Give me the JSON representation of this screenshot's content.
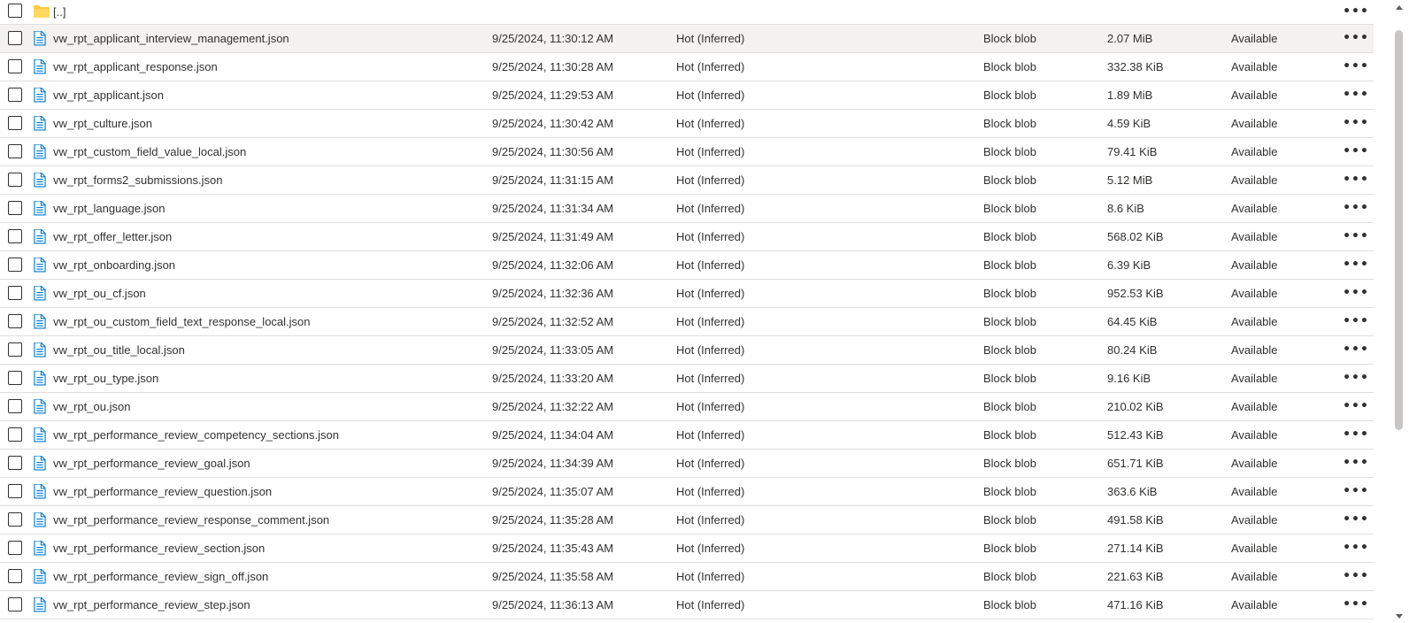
{
  "parent_folder": {
    "name": "[..]",
    "icon": "folder-icon",
    "more_label": "•••"
  },
  "colors": {
    "folder": "#ffc83d",
    "file_icon": "#0078d4",
    "selected_row": "#f3f2f1"
  },
  "rows": [
    {
      "name": "vw_rpt_applicant_interview_management.json",
      "modified": "9/25/2024, 11:30:12 AM",
      "tier": "Hot (Inferred)",
      "type": "Block blob",
      "size": "2.07 MiB",
      "lease": "Available",
      "selected": true
    },
    {
      "name": "vw_rpt_applicant_response.json",
      "modified": "9/25/2024, 11:30:28 AM",
      "tier": "Hot (Inferred)",
      "type": "Block blob",
      "size": "332.38 KiB",
      "lease": "Available"
    },
    {
      "name": "vw_rpt_applicant.json",
      "modified": "9/25/2024, 11:29:53 AM",
      "tier": "Hot (Inferred)",
      "type": "Block blob",
      "size": "1.89 MiB",
      "lease": "Available"
    },
    {
      "name": "vw_rpt_culture.json",
      "modified": "9/25/2024, 11:30:42 AM",
      "tier": "Hot (Inferred)",
      "type": "Block blob",
      "size": "4.59 KiB",
      "lease": "Available"
    },
    {
      "name": "vw_rpt_custom_field_value_local.json",
      "modified": "9/25/2024, 11:30:56 AM",
      "tier": "Hot (Inferred)",
      "type": "Block blob",
      "size": "79.41 KiB",
      "lease": "Available"
    },
    {
      "name": "vw_rpt_forms2_submissions.json",
      "modified": "9/25/2024, 11:31:15 AM",
      "tier": "Hot (Inferred)",
      "type": "Block blob",
      "size": "5.12 MiB",
      "lease": "Available"
    },
    {
      "name": "vw_rpt_language.json",
      "modified": "9/25/2024, 11:31:34 AM",
      "tier": "Hot (Inferred)",
      "type": "Block blob",
      "size": "8.6 KiB",
      "lease": "Available"
    },
    {
      "name": "vw_rpt_offer_letter.json",
      "modified": "9/25/2024, 11:31:49 AM",
      "tier": "Hot (Inferred)",
      "type": "Block blob",
      "size": "568.02 KiB",
      "lease": "Available"
    },
    {
      "name": "vw_rpt_onboarding.json",
      "modified": "9/25/2024, 11:32:06 AM",
      "tier": "Hot (Inferred)",
      "type": "Block blob",
      "size": "6.39 KiB",
      "lease": "Available"
    },
    {
      "name": "vw_rpt_ou_cf.json",
      "modified": "9/25/2024, 11:32:36 AM",
      "tier": "Hot (Inferred)",
      "type": "Block blob",
      "size": "952.53 KiB",
      "lease": "Available"
    },
    {
      "name": "vw_rpt_ou_custom_field_text_response_local.json",
      "modified": "9/25/2024, 11:32:52 AM",
      "tier": "Hot (Inferred)",
      "type": "Block blob",
      "size": "64.45 KiB",
      "lease": "Available"
    },
    {
      "name": "vw_rpt_ou_title_local.json",
      "modified": "9/25/2024, 11:33:05 AM",
      "tier": "Hot (Inferred)",
      "type": "Block blob",
      "size": "80.24 KiB",
      "lease": "Available"
    },
    {
      "name": "vw_rpt_ou_type.json",
      "modified": "9/25/2024, 11:33:20 AM",
      "tier": "Hot (Inferred)",
      "type": "Block blob",
      "size": "9.16 KiB",
      "lease": "Available"
    },
    {
      "name": "vw_rpt_ou.json",
      "modified": "9/25/2024, 11:32:22 AM",
      "tier": "Hot (Inferred)",
      "type": "Block blob",
      "size": "210.02 KiB",
      "lease": "Available"
    },
    {
      "name": "vw_rpt_performance_review_competency_sections.json",
      "modified": "9/25/2024, 11:34:04 AM",
      "tier": "Hot (Inferred)",
      "type": "Block blob",
      "size": "512.43 KiB",
      "lease": "Available"
    },
    {
      "name": "vw_rpt_performance_review_goal.json",
      "modified": "9/25/2024, 11:34:39 AM",
      "tier": "Hot (Inferred)",
      "type": "Block blob",
      "size": "651.71 KiB",
      "lease": "Available"
    },
    {
      "name": "vw_rpt_performance_review_question.json",
      "modified": "9/25/2024, 11:35:07 AM",
      "tier": "Hot (Inferred)",
      "type": "Block blob",
      "size": "363.6 KiB",
      "lease": "Available"
    },
    {
      "name": "vw_rpt_performance_review_response_comment.json",
      "modified": "9/25/2024, 11:35:28 AM",
      "tier": "Hot (Inferred)",
      "type": "Block blob",
      "size": "491.58 KiB",
      "lease": "Available"
    },
    {
      "name": "vw_rpt_performance_review_section.json",
      "modified": "9/25/2024, 11:35:43 AM",
      "tier": "Hot (Inferred)",
      "type": "Block blob",
      "size": "271.14 KiB",
      "lease": "Available"
    },
    {
      "name": "vw_rpt_performance_review_sign_off.json",
      "modified": "9/25/2024, 11:35:58 AM",
      "tier": "Hot (Inferred)",
      "type": "Block blob",
      "size": "221.63 KiB",
      "lease": "Available"
    },
    {
      "name": "vw_rpt_performance_review_step.json",
      "modified": "9/25/2024, 11:36:13 AM",
      "tier": "Hot (Inferred)",
      "type": "Block blob",
      "size": "471.16 KiB",
      "lease": "Available"
    }
  ],
  "row_icon": "file-icon",
  "more_label": "•••"
}
